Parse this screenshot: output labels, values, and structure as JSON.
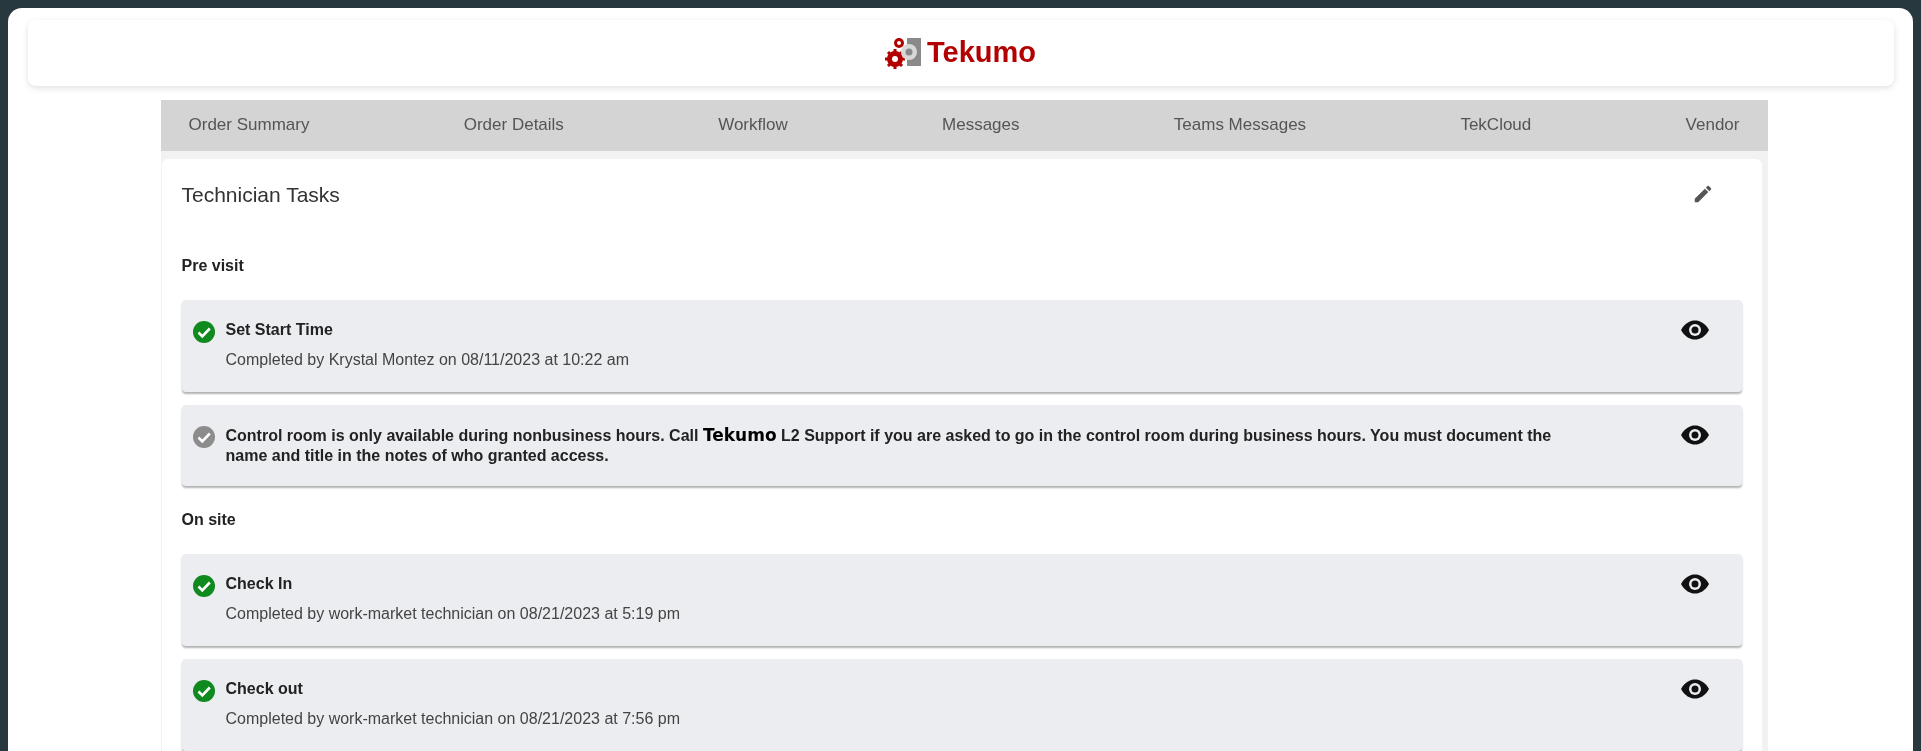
{
  "header": {
    "logo_text": "Tekumo"
  },
  "tabs": [
    {
      "label": "Order Summary",
      "selected": false
    },
    {
      "label": "Order Details",
      "selected": false
    },
    {
      "label": "Workflow",
      "selected": false
    },
    {
      "label": "Messages",
      "selected": false
    },
    {
      "label": "Teams Messages",
      "selected": false
    },
    {
      "label": "TekCloud",
      "selected": false
    },
    {
      "label": "Vendor",
      "selected": false
    }
  ],
  "panel": {
    "title": "Technician Tasks",
    "sections": [
      {
        "heading": "Pre visit",
        "tasks": [
          {
            "completed": true,
            "title_parts": [
              {
                "kind": "plain",
                "text": "Set Start Time"
              }
            ],
            "detail": "Completed by Krystal Montez on 08/11/2023 at 10:22 am"
          },
          {
            "completed": false,
            "title_parts": [
              {
                "kind": "plain",
                "text": "Control room is only available during nonbusiness hours. Call "
              },
              {
                "kind": "brand",
                "text": "Tekumo"
              },
              {
                "kind": "plain",
                "text": " L2 Support if you are asked to go in the control room during business hours. You must document the name and title in the notes of who granted access."
              }
            ]
          }
        ]
      },
      {
        "heading": "On site",
        "tasks": [
          {
            "completed": true,
            "title_parts": [
              {
                "kind": "plain",
                "text": "Check In"
              }
            ],
            "detail": "Completed by work-market technician on 08/21/2023 at 5:19 pm"
          },
          {
            "completed": true,
            "title_parts": [
              {
                "kind": "plain",
                "text": "Check out"
              }
            ],
            "detail": "Completed by work-market technician on 08/21/2023 at 7:56 pm"
          }
        ]
      }
    ]
  }
}
